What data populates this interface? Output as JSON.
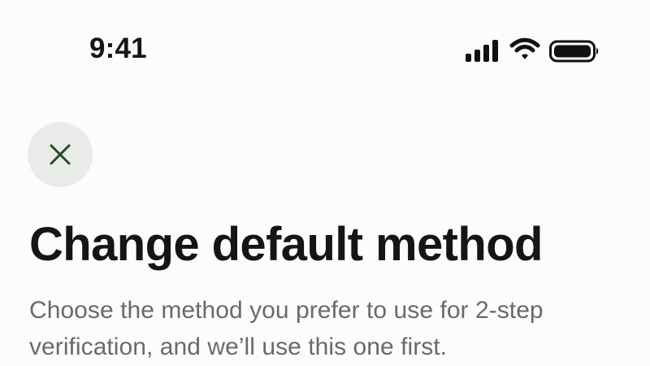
{
  "status_bar": {
    "time": "9:41",
    "icons": [
      "signal-icon",
      "wifi-icon",
      "battery-icon"
    ]
  },
  "header": {
    "close_icon": "close-icon"
  },
  "main": {
    "title": "Change default method",
    "description": "Choose the method you prefer to use for 2-step verification, and we’ll use this one first."
  },
  "colors": {
    "background": "#fdfbfd",
    "close_button_background": "#e9ebe8",
    "close_icon": "#1f4d24",
    "title": "#151515",
    "description": "#6a6a6a"
  }
}
